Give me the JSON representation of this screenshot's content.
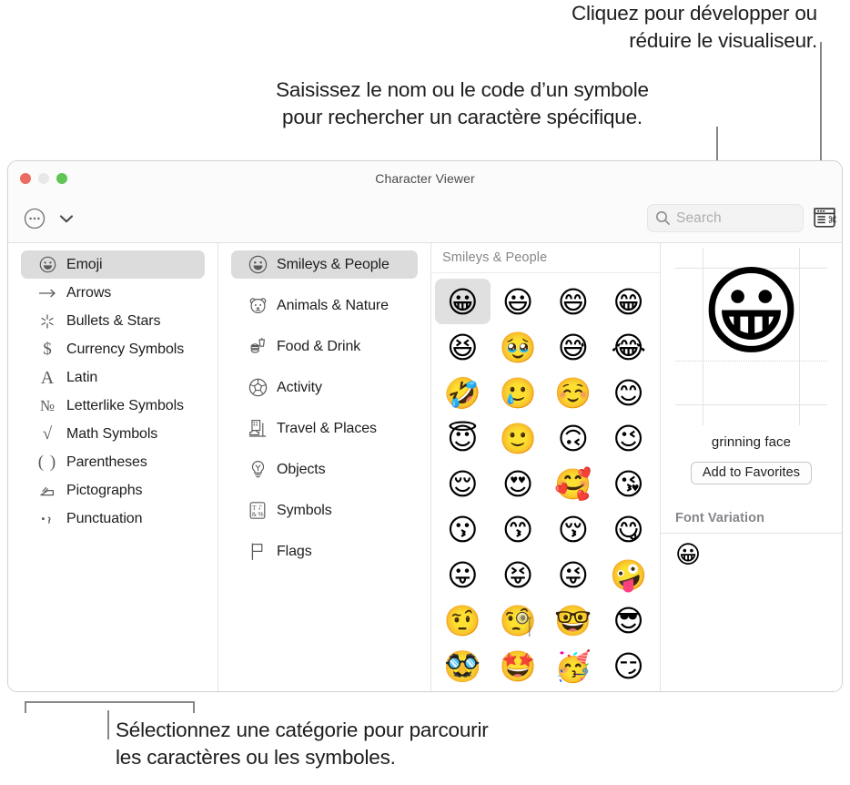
{
  "callouts": {
    "top_right": "Cliquez pour développer ou\nréduire le visualiseur.",
    "search": "Saisissez le nom ou le code d’un symbole\npour rechercher un caractère spécifique.",
    "bottom": "Sélectionnez une catégorie pour parcourir\nles caractères ou les symboles."
  },
  "window": {
    "title": "Character Viewer",
    "traffic_lights": [
      "close-button",
      "minimize-button",
      "zoom-button"
    ]
  },
  "toolbar": {
    "more_icon": "ellipsis-circle-icon",
    "chevron_icon": "chevron-down-icon",
    "search": {
      "icon": "search-icon",
      "placeholder": "Search",
      "value": ""
    },
    "viewer_toggle_icon": "character-viewer-toggle-icon"
  },
  "categories": {
    "selected": "Emoji",
    "items": [
      {
        "label": "Emoji",
        "icon": "emoji-smiley-icon",
        "glyph": "☺",
        "selected": true
      },
      {
        "label": "Arrows",
        "icon": "arrow-right-icon",
        "glyph": "⟶",
        "selected": false
      },
      {
        "label": "Bullets & Stars",
        "icon": "star-burst-icon",
        "glyph": "✳",
        "selected": false
      },
      {
        "label": "Currency Symbols",
        "icon": "dollar-sign-icon",
        "glyph": "$",
        "selected": false
      },
      {
        "label": "Latin",
        "icon": "letter-a-icon",
        "glyph": "A",
        "selected": false
      },
      {
        "label": "Letterlike Symbols",
        "icon": "numero-sign-icon",
        "glyph": "№",
        "selected": false
      },
      {
        "label": "Math Symbols",
        "icon": "square-root-icon",
        "glyph": "√",
        "selected": false
      },
      {
        "label": "Parentheses",
        "icon": "parentheses-icon",
        "glyph": "( )",
        "selected": false
      },
      {
        "label": "Pictographs",
        "icon": "pictograph-icon",
        "glyph": "✍",
        "selected": false
      },
      {
        "label": "Punctuation",
        "icon": "punctuation-icon",
        "glyph": "•,",
        "selected": false
      }
    ]
  },
  "subcategories": {
    "selected": "Smileys & People",
    "items": [
      {
        "label": "Smileys & People",
        "icon": "smiley-face-icon",
        "glyph": "☺",
        "selected": true
      },
      {
        "label": "Animals & Nature",
        "icon": "bear-face-icon",
        "glyph": "ᴥ",
        "selected": false
      },
      {
        "label": "Food & Drink",
        "icon": "burger-drink-icon",
        "glyph": "⌸",
        "selected": false
      },
      {
        "label": "Activity",
        "icon": "soccer-ball-icon",
        "glyph": "⚽",
        "selected": false
      },
      {
        "label": "Travel & Places",
        "icon": "city-car-icon",
        "glyph": "⛫",
        "selected": false
      },
      {
        "label": "Objects",
        "icon": "lightbulb-icon",
        "glyph": "♀",
        "selected": false
      },
      {
        "label": "Symbols",
        "icon": "symbols-box-icon",
        "glyph": "▣",
        "selected": false
      },
      {
        "label": "Flags",
        "icon": "flag-icon",
        "glyph": "⚐",
        "selected": false
      }
    ]
  },
  "grid": {
    "header": "Smileys & People",
    "selected_index": 0,
    "emoji": [
      "😀",
      "😃",
      "😄",
      "😁",
      "😆",
      "🥹",
      "😅",
      "😂",
      "🤣",
      "🥲",
      "☺️",
      "😊",
      "😇",
      "🙂",
      "🙃",
      "😉",
      "😌",
      "😍",
      "🥰",
      "😘",
      "😗",
      "😙",
      "😚",
      "😋",
      "😛",
      "😝",
      "😜",
      "🤪",
      "🤨",
      "🧐",
      "🤓",
      "😎",
      "🥸",
      "🤩",
      "🥳",
      "😏"
    ]
  },
  "detail": {
    "preview_glyph": "😀",
    "character_name": "grinning face",
    "add_to_favorites_label": "Add to Favorites",
    "font_variation_title": "Font Variation",
    "font_variations": [
      "😀"
    ]
  },
  "colors": {
    "selection_gray": "#dcdcdc",
    "window_chrome": "#fbfbfb",
    "divider": "#e3e3e3",
    "muted_text": "#86868b",
    "traffic_red": "#ec6a5f",
    "traffic_yellow": "#e8e8e8",
    "traffic_green": "#61c554"
  }
}
